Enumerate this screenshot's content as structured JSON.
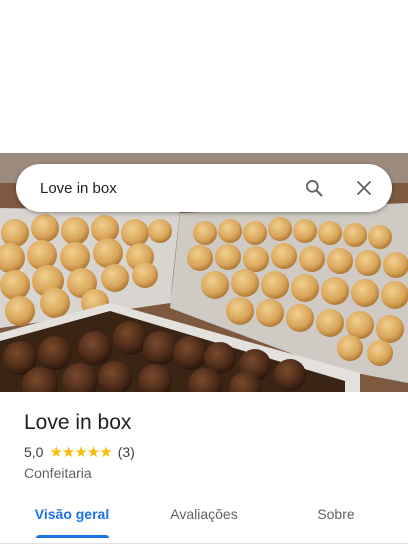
{
  "search": {
    "query": "Love in box",
    "search_icon": "search-icon",
    "close_icon": "close-icon"
  },
  "hero": {
    "image": "photo of trays of coxinhas and brigadeiros"
  },
  "place": {
    "name": "Love in box",
    "rating": "5,0",
    "stars": "★★★★★",
    "review_count": "(3)",
    "category": "Confeitaria"
  },
  "tabs": [
    {
      "label": "Visão geral",
      "active": true
    },
    {
      "label": "Avaliações",
      "active": false
    },
    {
      "label": "Sobre",
      "active": false
    }
  ],
  "colors": {
    "accent": "#1a73e8",
    "star": "#fbbc04",
    "text": "#202124",
    "secondary_text": "#5f6368"
  }
}
